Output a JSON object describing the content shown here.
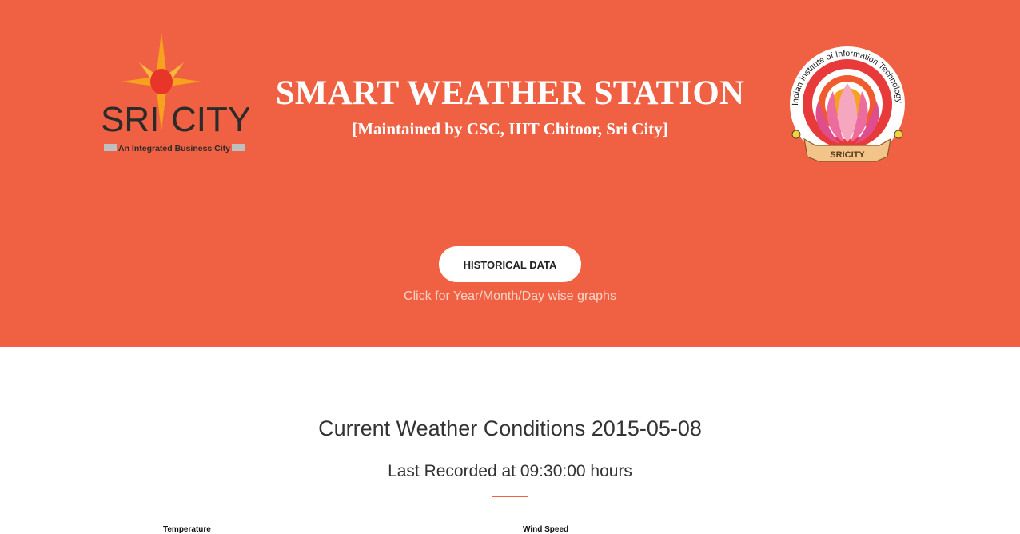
{
  "header": {
    "title": "SMART WEATHER STATION",
    "subtitle": "[Maintained by CSC, IIIT Chitoor, Sri City]",
    "left_logo": {
      "icon": "sri-city-logo",
      "text_main_left": "SRI",
      "text_main_right": "CITY",
      "tagline": "An Integrated Business City"
    },
    "right_logo": {
      "icon": "iiit-chittoor-emblem",
      "ring_text": "Indian Institute of Information Technology Chittoor",
      "ribbon_text": "SRICITY"
    }
  },
  "historical": {
    "button_label": "HISTORICAL DATA",
    "caption": "Click for Year/Month/Day wise graphs"
  },
  "current": {
    "title": "Current Weather Conditions 2015-05-08",
    "last_recorded": "Last Recorded at 09:30:00 hours"
  },
  "metrics": {
    "temperature_label": "Temperature",
    "wind_speed_label": "Wind Speed"
  },
  "colors": {
    "hero_bg": "#ef6142",
    "accent": "#ef6142",
    "star_orange": "#f6a21e",
    "star_red": "#e8352a"
  }
}
